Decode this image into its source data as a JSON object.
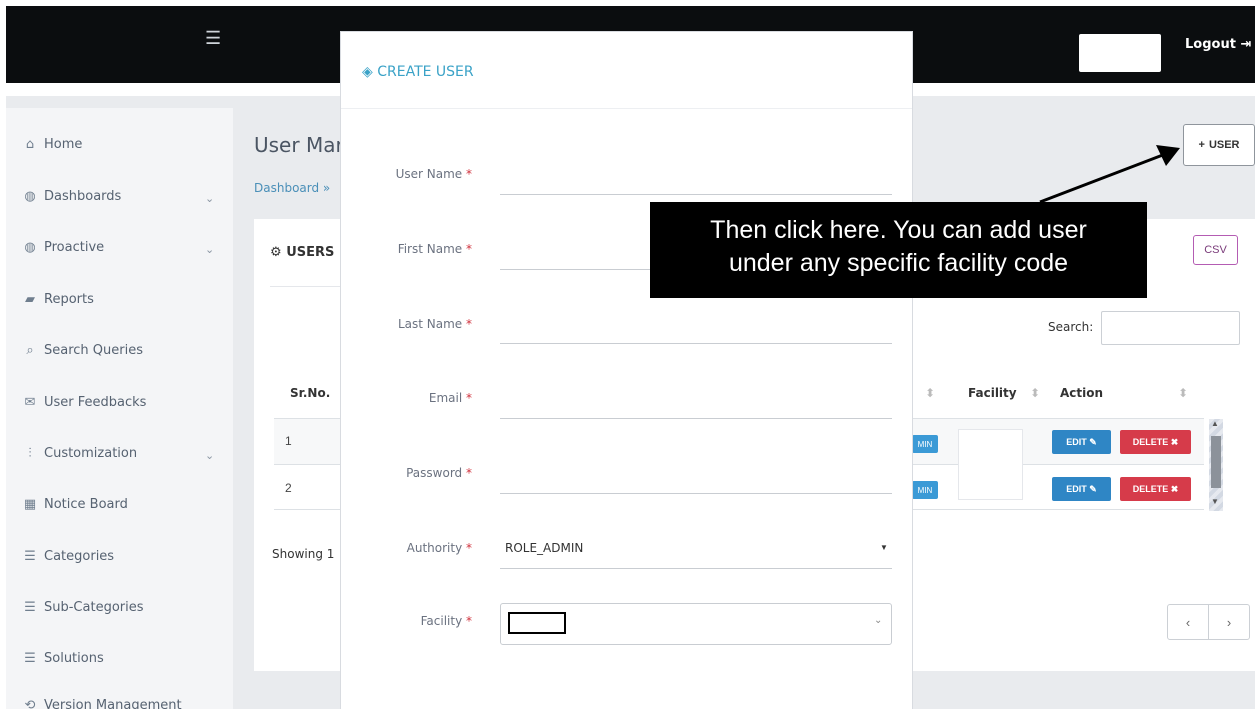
{
  "topbar": {
    "menu_icon": "hamburger-icon",
    "logout_label": "Logout",
    "logout_icon": "logout-icon"
  },
  "sidebar": {
    "items": [
      {
        "label": "Home",
        "icon": "home-icon",
        "expandable": false
      },
      {
        "label": "Dashboards",
        "icon": "dashboard-icon",
        "expandable": true
      },
      {
        "label": "Proactive",
        "icon": "dashboard-icon",
        "expandable": true
      },
      {
        "label": "Reports",
        "icon": "folder-icon",
        "expandable": false
      },
      {
        "label": "Search Queries",
        "icon": "search-icon",
        "expandable": false
      },
      {
        "label": "User Feedbacks",
        "icon": "envelope-icon",
        "expandable": false
      },
      {
        "label": "Customization",
        "icon": "sliders-icon",
        "expandable": true
      },
      {
        "label": "Notice Board",
        "icon": "board-icon",
        "expandable": false
      },
      {
        "label": "Categories",
        "icon": "list-icon",
        "expandable": false
      },
      {
        "label": "Sub-Categories",
        "icon": "list-icon",
        "expandable": false
      },
      {
        "label": "Solutions",
        "icon": "list-icon",
        "expandable": false
      },
      {
        "label": "Version Management",
        "icon": "version-icon",
        "expandable": false
      }
    ]
  },
  "main": {
    "title": "User Mar",
    "breadcrumb": "Dashboard »",
    "add_user_label": "USER",
    "panel_title": "USERS",
    "csv_label": "CSV",
    "search_label": "Search:",
    "table": {
      "headers": [
        "Sr.No.",
        "Facility",
        "Action"
      ],
      "rows": [
        {
          "sr": "1",
          "role": "MIN",
          "edit": "EDIT",
          "delete": "DELETE"
        },
        {
          "sr": "2",
          "role": "MIN",
          "edit": "EDIT",
          "delete": "DELETE"
        }
      ]
    },
    "showing": "Showing 1",
    "pager": {
      "prev": "‹",
      "next": "›"
    }
  },
  "modal": {
    "title": "CREATE USER",
    "fields": [
      {
        "label": "User Name",
        "required": "*"
      },
      {
        "label": "First Name",
        "required": "*"
      },
      {
        "label": "Last Name",
        "required": "*"
      },
      {
        "label": "Email",
        "required": "*"
      },
      {
        "label": "Password",
        "required": "*"
      },
      {
        "label": "Authority",
        "required": "*"
      },
      {
        "label": "Facility",
        "required": "*"
      }
    ],
    "authority_value": "ROLE_ADMIN"
  },
  "annotation": {
    "text_line1": "Then click here. You can add user",
    "text_line2": "under any specific facility code"
  },
  "colors": {
    "topbar": "#0b0d0f",
    "accent": "#3aa2c7",
    "edit": "#2f86c5",
    "delete": "#d63b4a",
    "required": "#d0313c"
  }
}
